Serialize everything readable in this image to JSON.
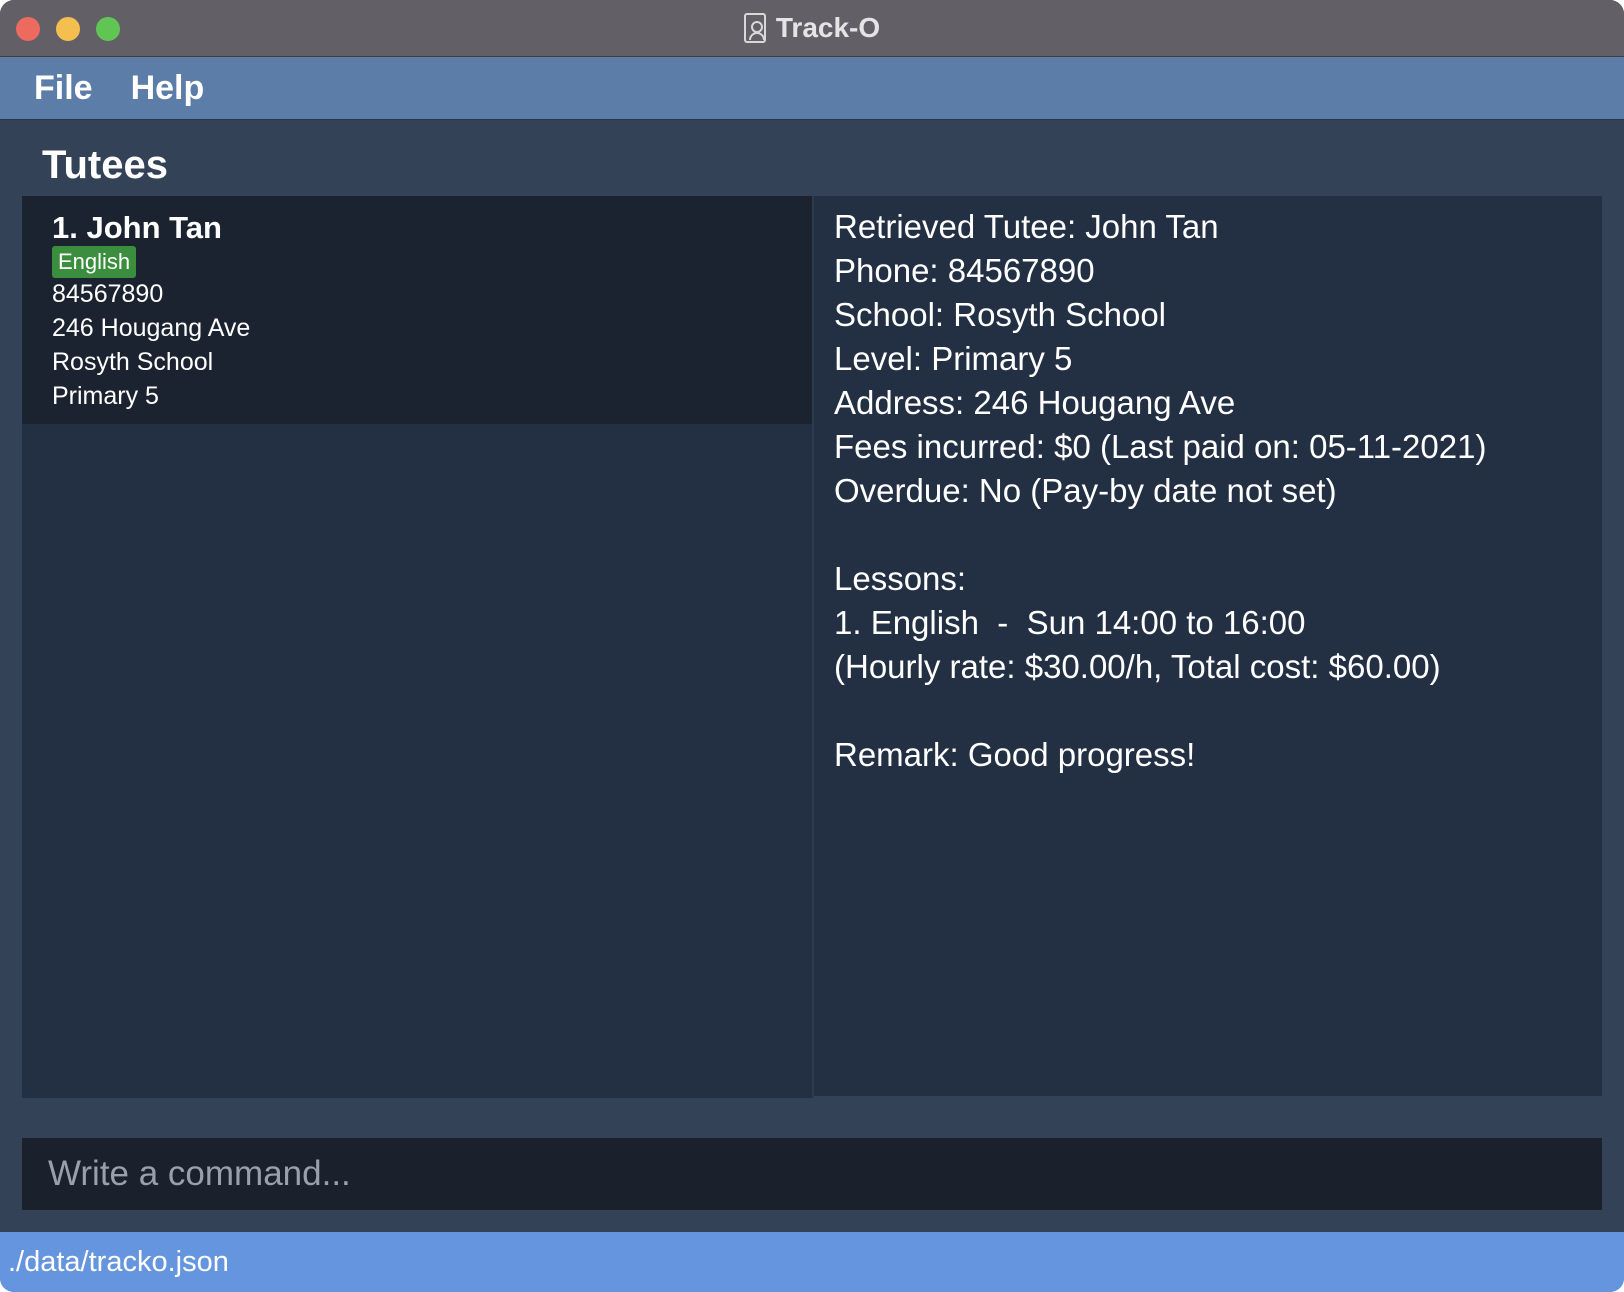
{
  "window": {
    "title": "Track-O",
    "icon": "address-book-icon"
  },
  "menu": {
    "file": "File",
    "help": "Help"
  },
  "tutees": {
    "section_title": "Tutees",
    "items": [
      {
        "index_name": "1.  John Tan",
        "tag": "English",
        "phone": "84567890",
        "address": "246 Hougang Ave",
        "school": "Rosyth School",
        "level": "Primary 5"
      }
    ]
  },
  "result": {
    "lines": [
      "Retrieved Tutee: John Tan",
      "Phone: 84567890",
      "School: Rosyth School",
      "Level: Primary 5",
      "Address: 246 Hougang Ave",
      "Fees incurred: $0 (Last paid on: 05-11-2021)",
      "Overdue: No (Pay-by date not set)",
      "Lessons:",
      "1. English  -  Sun 14:00 to 16:00",
      "(Hourly rate: $30.00/h, Total cost: $60.00)",
      "Remark: Good progress!"
    ]
  },
  "command": {
    "placeholder": "Write a command..."
  },
  "status": {
    "file_path": "./data/tracko.json"
  },
  "colors": {
    "tag_bg": "#3a8e3e",
    "menubar": "#5b7da8",
    "statusbar": "#6595de",
    "background": "#334256"
  }
}
